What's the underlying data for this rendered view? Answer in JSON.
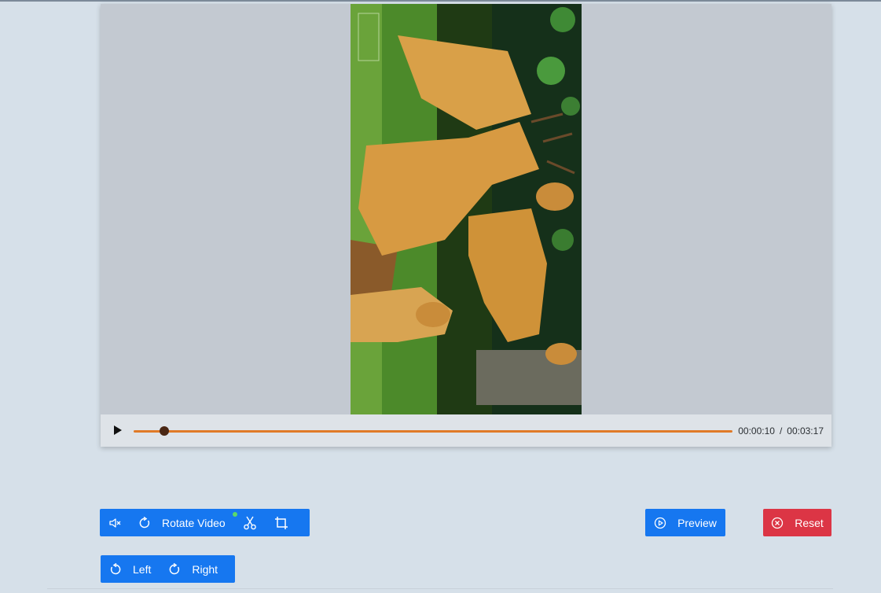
{
  "player": {
    "video_thumbnail": "deer-in-grass-rotated",
    "play_icon": "play-icon",
    "progress_fraction": 0.051,
    "current_time": "00:00:10",
    "time_separator": "/",
    "total_time": "00:03:17",
    "progress_color": "#e07a27",
    "thumb_color": "#4a2714"
  },
  "toolbar": {
    "mute_icon": "mute-icon",
    "rotate_icon": "rotate-icon",
    "rotate_label": "Rotate Video",
    "rotate_active_indicator": true,
    "cut_icon": "scissors-icon",
    "crop_icon": "crop-icon"
  },
  "rotate_options": {
    "left_label": "Left",
    "right_label": "Right"
  },
  "actions": {
    "preview_label": "Preview",
    "reset_label": "Reset"
  },
  "colors": {
    "primary": "#1677f0",
    "danger": "#dc3545",
    "background": "#d6e0e9",
    "active_dot": "#5bd96a"
  }
}
